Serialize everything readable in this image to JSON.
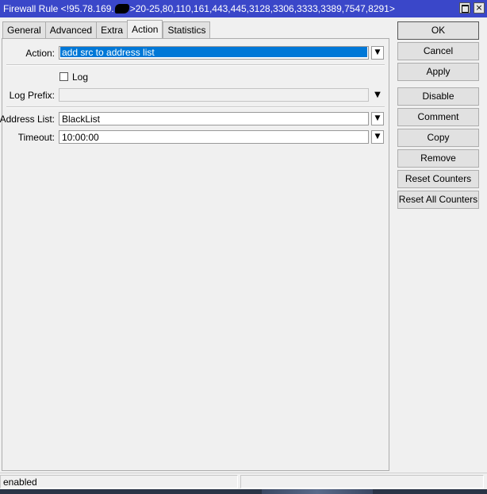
{
  "window": {
    "title_prefix": "Firewall Rule <!95.78.169.",
    "title_suffix": ">20-25,80,110,161,443,445,3128,3306,3333,3389,7547,8291>",
    "maximize_label": "",
    "close_label": "×"
  },
  "tabs": [
    {
      "label": "General"
    },
    {
      "label": "Advanced"
    },
    {
      "label": "Extra"
    },
    {
      "label": "Action"
    },
    {
      "label": "Statistics"
    }
  ],
  "form": {
    "action": {
      "label": "Action:",
      "value": "add src to address list"
    },
    "log": {
      "label": "Log",
      "checked": false
    },
    "log_prefix": {
      "label": "Log Prefix:",
      "value": ""
    },
    "address_list": {
      "label": "Address List:",
      "value": "BlackList"
    },
    "timeout": {
      "label": "Timeout:",
      "value": "10:00:00"
    }
  },
  "buttons": {
    "ok": "OK",
    "cancel": "Cancel",
    "apply": "Apply",
    "disable": "Disable",
    "comment": "Comment",
    "copy": "Copy",
    "remove": "Remove",
    "reset_counters": "Reset Counters",
    "reset_all_counters": "Reset All Counters"
  },
  "status": {
    "state": "enabled",
    "second": ""
  }
}
